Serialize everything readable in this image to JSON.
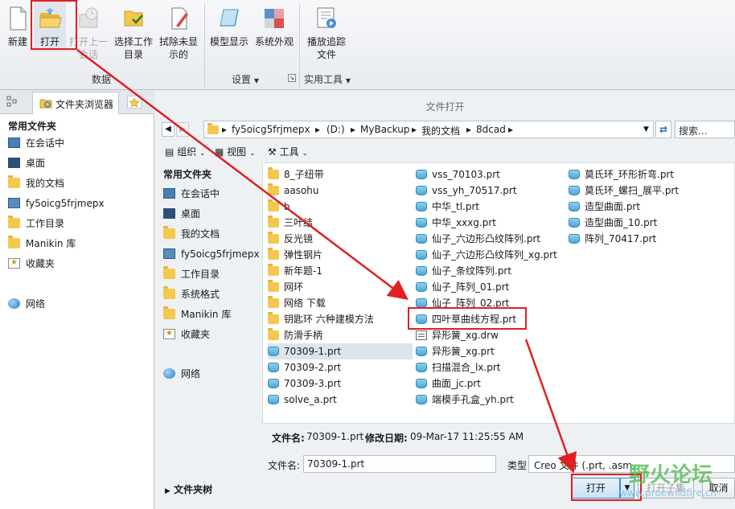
{
  "ribbon": {
    "buttons": [
      {
        "label": "新建",
        "icon": "new-file-icon"
      },
      {
        "label": "打开",
        "icon": "open-folder-icon"
      },
      {
        "label_line1": "打开上一",
        "label_line2": "会话",
        "icon": "open-last-session-icon"
      },
      {
        "label_line1": "选择工作",
        "label_line2": "目录",
        "icon": "select-working-dir-icon"
      },
      {
        "label_line1": "拭除未显",
        "label_line2": "示的",
        "icon": "erase-not-displayed-icon"
      },
      {
        "label": "模型显示",
        "icon": "model-display-icon"
      },
      {
        "label": "系统外观",
        "icon": "system-appearance-icon"
      },
      {
        "label_line1": "播放追踪",
        "label_line2": "文件",
        "icon": "play-trail-icon"
      }
    ],
    "groups": {
      "data": "数据",
      "settings": "设置",
      "utilities": "实用工具"
    }
  },
  "left_pane": {
    "tab_label": "文件夹浏览器",
    "section_title": "常用文件夹",
    "items": [
      "在会话中",
      "桌面",
      "我的文档",
      "fy5oicg5frjmepx",
      "工作目录",
      "Manikin 库",
      "收藏夹"
    ],
    "network": "网络"
  },
  "dialog": {
    "title": "文件打开",
    "path": [
      "fy5oicg5frjmepx",
      "(D:)",
      "MyBackup",
      "我的文档",
      "8dcad"
    ],
    "search_placeholder": "搜索...",
    "toolbar": {
      "organize": "组织",
      "view": "视图",
      "tools": "工具"
    },
    "nav_title": "常用文件夹",
    "nav_items": [
      "在会话中",
      "桌面",
      "我的文档",
      "fy5oicg5frjmepx",
      "工作目录",
      "系统格式",
      "Manikin 库",
      "收藏夹"
    ],
    "nav_network": "网络",
    "folder_tree": "文件夹树",
    "col1": [
      {
        "name": "8_子纽带",
        "type": "folder"
      },
      {
        "name": "aasohu",
        "type": "folder"
      },
      {
        "name": "b",
        "type": "folder"
      },
      {
        "name": "三叶结",
        "type": "folder"
      },
      {
        "name": "反光镜",
        "type": "folder"
      },
      {
        "name": "弹性钢片",
        "type": "folder"
      },
      {
        "name": "新年题-1",
        "type": "folder"
      },
      {
        "name": "网环",
        "type": "folder"
      },
      {
        "name": "网络 下载",
        "type": "folder"
      },
      {
        "name": "钥匙环 六种建模方法",
        "type": "folder"
      },
      {
        "name": "防滑手柄",
        "type": "folder"
      },
      {
        "name": "70309-1.prt",
        "type": "part"
      },
      {
        "name": "70309-2.prt",
        "type": "part"
      },
      {
        "name": "70309-3.prt",
        "type": "part"
      },
      {
        "name": "solve_a.prt",
        "type": "part"
      }
    ],
    "col2": [
      {
        "name": "vss_70103.prt",
        "type": "part"
      },
      {
        "name": "vss_yh_70517.prt",
        "type": "part"
      },
      {
        "name": "中华_tl.prt",
        "type": "part"
      },
      {
        "name": "中华_xxxg.prt",
        "type": "part"
      },
      {
        "name": "仙子_六边形凸纹阵列.prt",
        "type": "part"
      },
      {
        "name": "仙子_六边形凸纹阵列_xg.prt",
        "type": "part"
      },
      {
        "name": "仙子_条纹阵列.prt",
        "type": "part"
      },
      {
        "name": "仙子_阵列_01.prt",
        "type": "part"
      },
      {
        "name": "仙子_阵列_02.prt",
        "type": "part"
      },
      {
        "name": "四叶草曲线方程.prt",
        "type": "part"
      },
      {
        "name": "异形簧_xg.drw",
        "type": "drw"
      },
      {
        "name": "异形簧_xg.prt",
        "type": "part"
      },
      {
        "name": "扫描混合_lx.prt",
        "type": "part"
      },
      {
        "name": "曲面_jc.prt",
        "type": "part"
      },
      {
        "name": "端模手孔盒_yh.prt",
        "type": "part"
      }
    ],
    "col3": [
      {
        "name": "莫氏环_环形折弯.prt",
        "type": "part"
      },
      {
        "name": "莫氏环_螺扫_展平.prt",
        "type": "part"
      },
      {
        "name": "造型曲面.prt",
        "type": "part"
      },
      {
        "name": "造型曲面_10.prt",
        "type": "part"
      },
      {
        "name": "阵列_70417.prt",
        "type": "part"
      }
    ],
    "info": {
      "name_label": "文件名:",
      "name_value": "70309-1.prt",
      "date_label": "修改日期:",
      "date_value": "09-Mar-17 11:25:55 AM"
    },
    "filename_label": "文件名:",
    "filename_value": "70309-1.prt",
    "type_label": "类型",
    "type_value": "Creo 文件 (.prt, .asm,",
    "open_button": "打开",
    "open_sub_button": "打开子集",
    "cancel_button": "取消"
  },
  "watermark": {
    "title": "野火论坛",
    "url": "www.proewildfire.cn"
  },
  "colors": {
    "annotation_red": "#e02020",
    "selection": "#dde4ec"
  }
}
